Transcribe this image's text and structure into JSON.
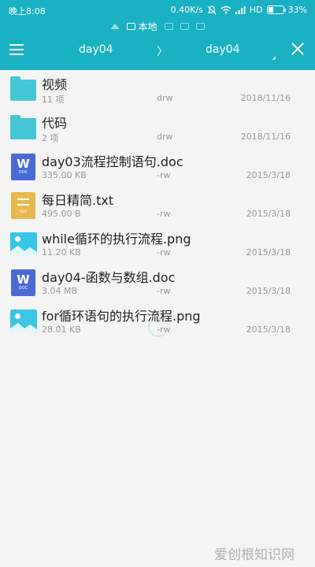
{
  "status_bar": {
    "time": "晚上8:08",
    "speed": "0.40K/s",
    "network": "HD",
    "battery": "33%",
    "battery_level": 0.33,
    "icons": [
      "mute-icon",
      "wifi-icon",
      "signal-icon",
      "battery-icon"
    ]
  },
  "header": {
    "tab_local": "本地",
    "breadcrumb": [
      "day04",
      "〉",
      "day04"
    ],
    "colors": {
      "bar": "#1ab1c2"
    }
  },
  "files": [
    {
      "icon": "folder-icon",
      "name": "视频",
      "size": "11 项",
      "perm": "drw",
      "date": "2018/11/16"
    },
    {
      "icon": "folder-icon",
      "name": "代码",
      "size": "2 项",
      "perm": "drw",
      "date": "2018/11/16"
    },
    {
      "icon": "doc-file-icon",
      "name": "day03流程控制语句.doc",
      "size": "335.00 KB",
      "perm": "-rw",
      "date": "2015/3/18",
      "glyph": "W",
      "ext": "DOC"
    },
    {
      "icon": "txt-file-icon",
      "name": "每日精简.txt",
      "size": "495.00 B",
      "perm": "-rw",
      "date": "2015/3/18",
      "ext": "TXT"
    },
    {
      "icon": "image-file-icon",
      "name": "while循环的执行流程.png",
      "size": "11.20 KB",
      "perm": "-rw",
      "date": "2015/3/18"
    },
    {
      "icon": "doc-file-icon",
      "name": "day04-函数与数组.doc",
      "size": "3.04 MB",
      "perm": "-rw",
      "date": "2015/3/18",
      "glyph": "W",
      "ext": "DOC"
    },
    {
      "icon": "image-file-icon",
      "name": "for循环语句的执行流程.png",
      "size": "28.01 KB",
      "perm": "-rw",
      "date": "2015/3/18"
    }
  ],
  "watermark": "爱创根知识网"
}
